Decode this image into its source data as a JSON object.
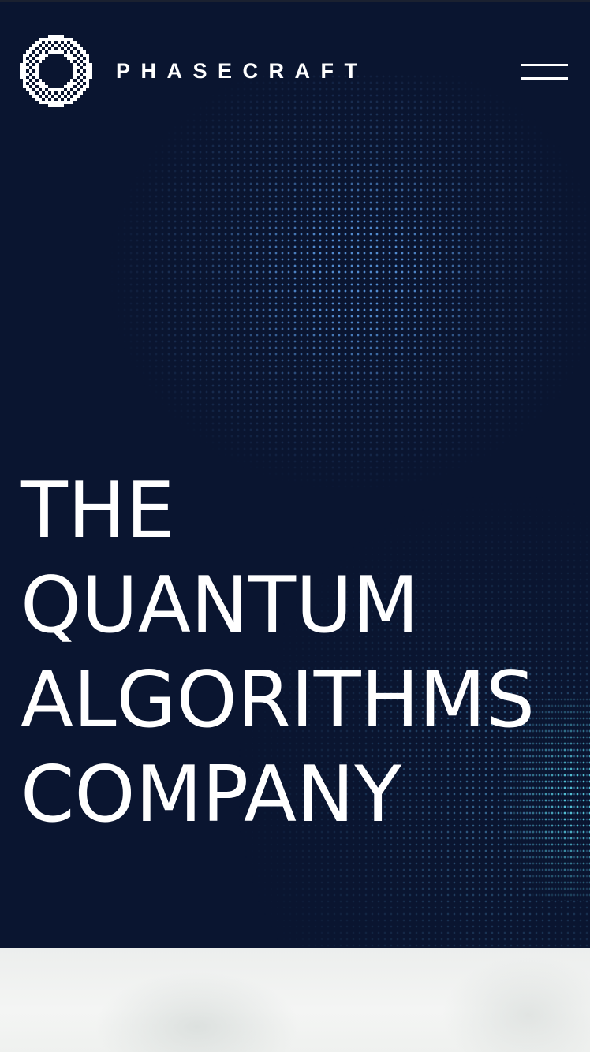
{
  "header": {
    "brand_name": "PHASECRAFT",
    "logo_icon": "dotted-ring-logo-icon",
    "menu_icon": "hamburger-menu-icon"
  },
  "hero": {
    "headline_lines": [
      "THE",
      "QUANTUM",
      "ALGORITHMS",
      "COMPANY"
    ]
  },
  "colors": {
    "background": "#0a1530",
    "text": "#ffffff",
    "dot_blue": "#5fa0eb",
    "dot_cyan": "#5ad2e6",
    "below_section": "#f0f2f1"
  }
}
